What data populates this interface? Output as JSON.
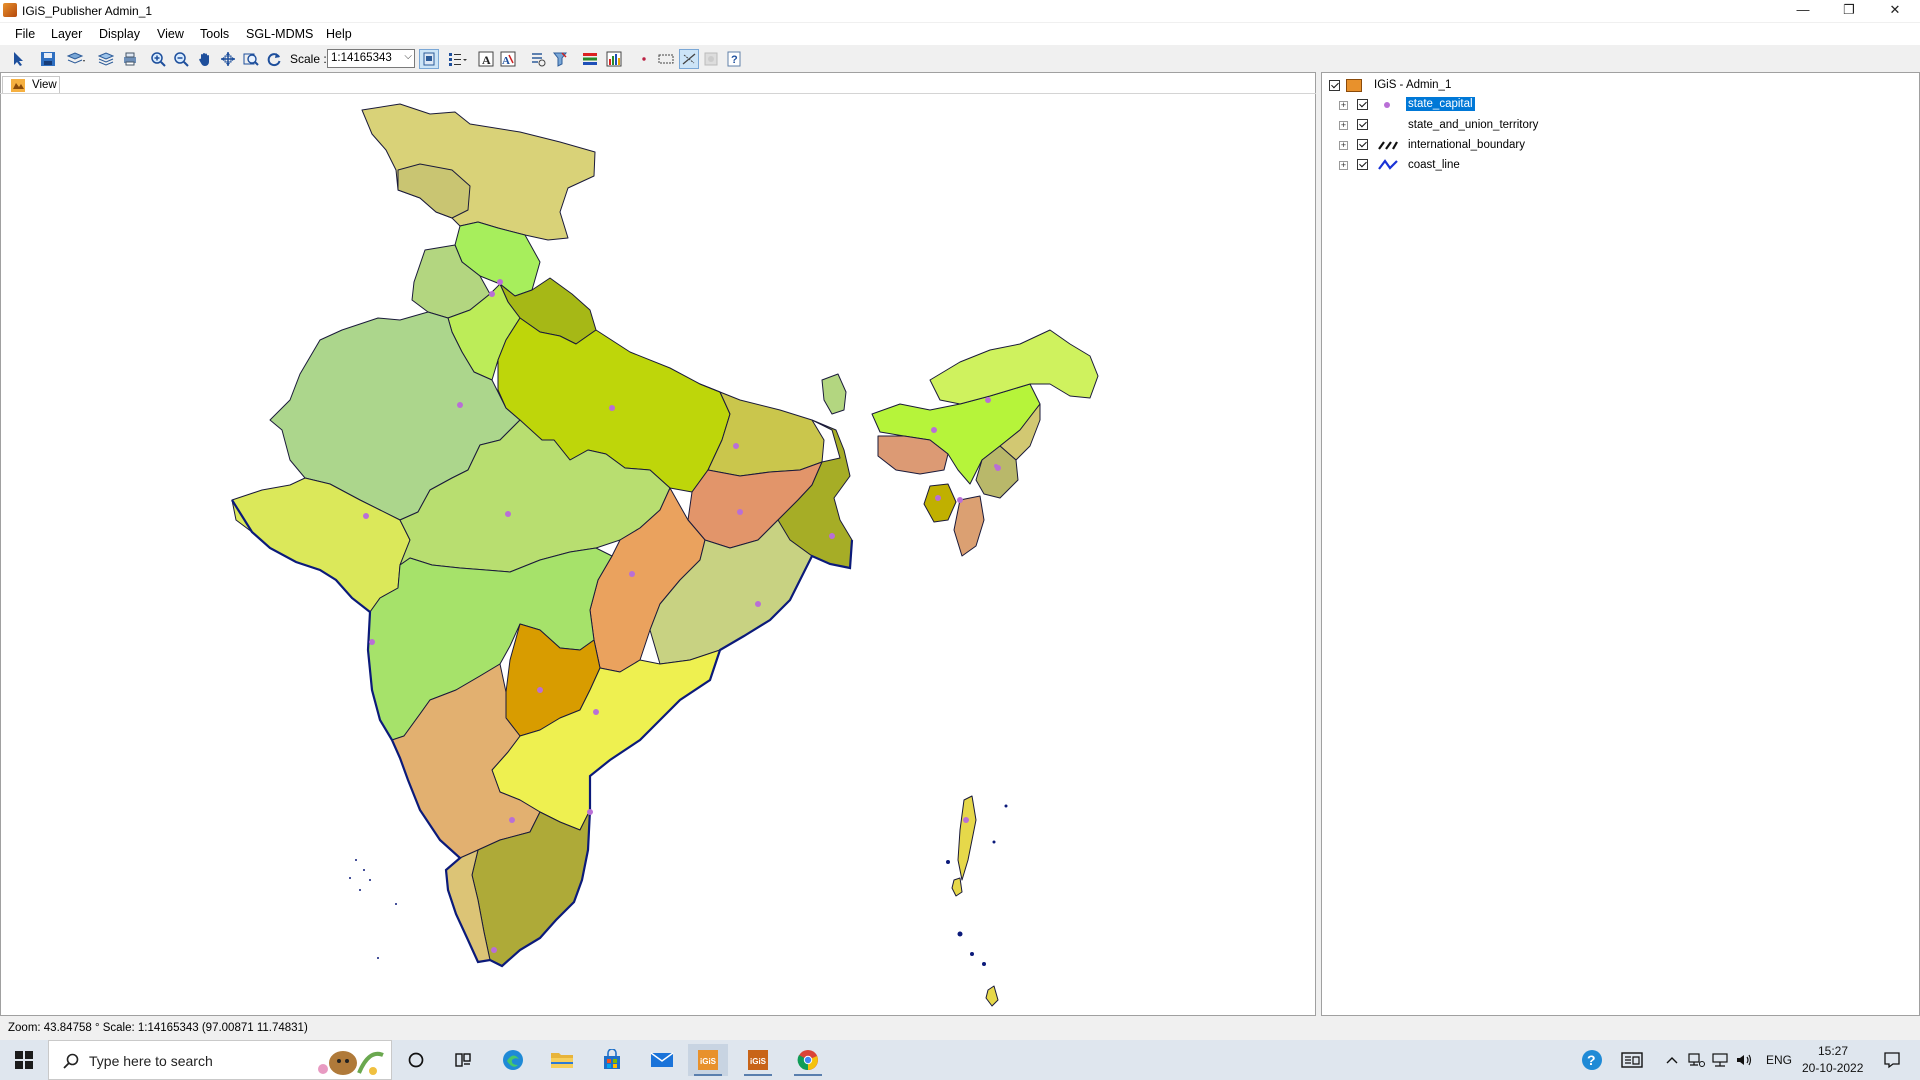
{
  "window": {
    "title": "IGiS_Publisher Admin_1",
    "controls": [
      "minimize",
      "restore",
      "close"
    ]
  },
  "menu": [
    "File",
    "Layer",
    "Display",
    "View",
    "Tools",
    "SGL-MDMS",
    "Help"
  ],
  "toolbar": {
    "scale_label": "Scale :",
    "scale_value": "1:14165343"
  },
  "view_tab": {
    "label": "View"
  },
  "toc": {
    "root": {
      "label": "IGiS - Admin_1",
      "checked": true
    },
    "layers": [
      {
        "label": "state_capital",
        "checked": true,
        "symbol": "point-icon",
        "selected": true
      },
      {
        "label": "state_and_union_territory",
        "checked": true,
        "symbol": "none"
      },
      {
        "label": "international_boundary",
        "checked": true,
        "symbol": "dashed-line-icon"
      },
      {
        "label": "coast_line",
        "checked": true,
        "symbol": "blue-line-icon"
      }
    ]
  },
  "status": {
    "text": "Zoom: 43.84758 °  Scale: 1:14165343  (97.00871  11.74831)"
  },
  "taskbar": {
    "search_placeholder": "Type here to search",
    "language": "ENG",
    "time": "15:27",
    "date": "20-10-2022"
  },
  "colors": {
    "selection": "#0078d7",
    "capital_point": "#b96fd6",
    "coast_line": "#0b1a7a"
  }
}
